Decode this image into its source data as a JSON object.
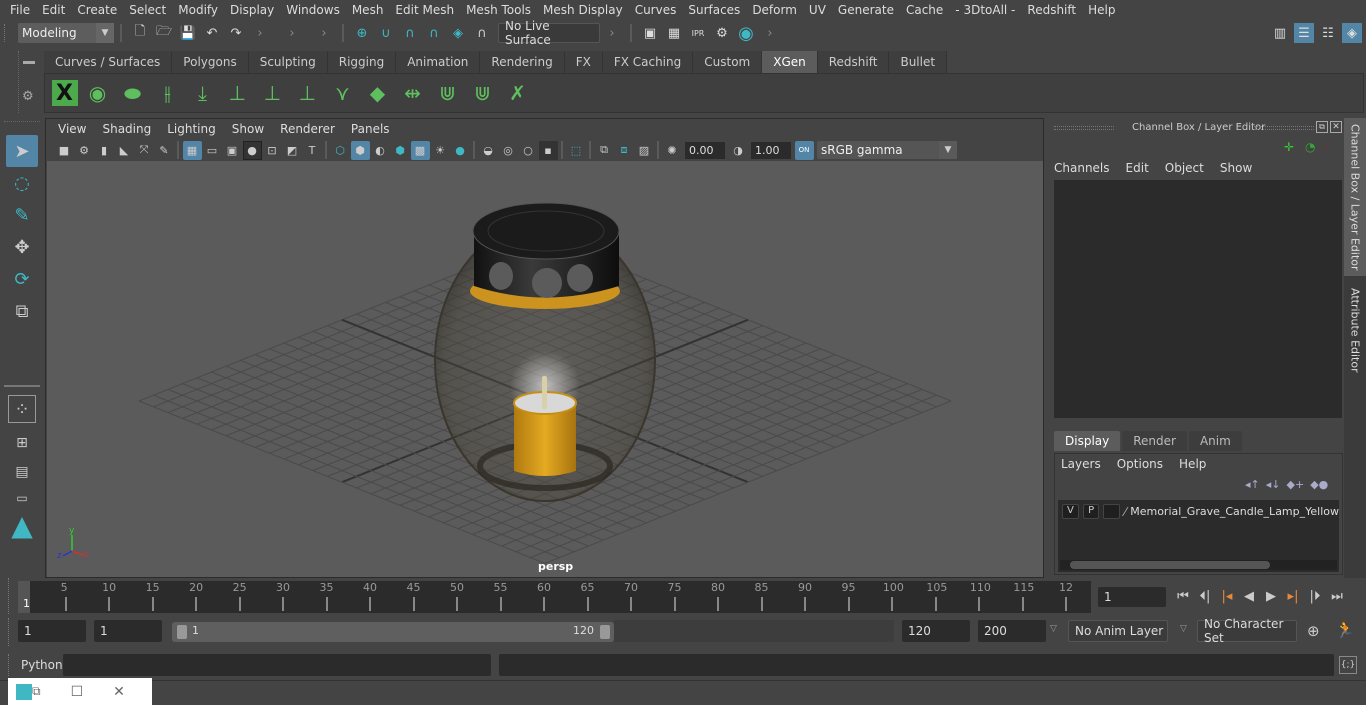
{
  "menubar": [
    "File",
    "Edit",
    "Create",
    "Select",
    "Modify",
    "Display",
    "Windows",
    "Mesh",
    "Edit Mesh",
    "Mesh Tools",
    "Mesh Display",
    "Curves",
    "Surfaces",
    "Deform",
    "UV",
    "Generate",
    "Cache",
    "- 3DtoAll -",
    "Redshift",
    "Help"
  ],
  "statusline": {
    "mode": "Modeling",
    "live_surface": "No Live Surface",
    "icons": [
      "new-scene-icon",
      "open-scene-icon",
      "save-scene-icon",
      "undo-icon",
      "redo-icon",
      "snap-grid-icon",
      "snap-curve-icon",
      "snap-point-icon",
      "snap-view-plane-icon",
      "snap-live-icon",
      "snap-magnet-icon",
      "render-view-icon",
      "render-icon",
      "ipr-render-icon",
      "render-settings-icon",
      "hypershade-icon"
    ],
    "right_icons": [
      "modeling-toolkit-icon",
      "attribute-editor-icon",
      "tool-settings-icon",
      "channel-box-icon"
    ]
  },
  "shelf": {
    "tabs": [
      "Curves / Surfaces",
      "Polygons",
      "Sculpting",
      "Rigging",
      "Animation",
      "Rendering",
      "FX",
      "FX Caching",
      "Custom",
      "XGen",
      "Redshift",
      "Bullet"
    ],
    "active_tab": "XGen",
    "icons": [
      "xgen-editor-icon",
      "xgen-preview-icon",
      "xgen-clear-preview-icon",
      "xgen-add-guides-icon",
      "xgen-place-guides-icon",
      "xgen-add-guide-icon",
      "xgen-show-guides-icon",
      "xgen-lock-guides-icon",
      "xgen-split-guide-icon",
      "xgen-sculpt-guides-icon",
      "xgen-flip-guides-icon",
      "xgen-select-guides-icon",
      "xgen-guide-bounds-icon",
      "xgen-delete-guides-icon"
    ]
  },
  "toolbox": [
    "select-tool-icon",
    "lasso-tool-icon",
    "paint-select-tool-icon",
    "move-tool-icon",
    "rotate-tool-icon",
    "scale-tool-icon"
  ],
  "viewport": {
    "menu": [
      "View",
      "Shading",
      "Lighting",
      "Show",
      "Renderer",
      "Panels"
    ],
    "exposure": "0.00",
    "gamma": "1.00",
    "color_space": "sRGB gamma",
    "color_mgmt_badge": "ON",
    "camera_label": "persp",
    "axis": {
      "x": "x",
      "y": "y",
      "z": "z"
    }
  },
  "channel_box": {
    "title": "Channel Box / Layer Editor",
    "menu": [
      "Channels",
      "Edit",
      "Object",
      "Show"
    ]
  },
  "layer_editor": {
    "tabs": [
      "Display",
      "Render",
      "Anim"
    ],
    "active_tab": "Display",
    "menu": [
      "Layers",
      "Options",
      "Help"
    ],
    "layers": [
      {
        "v": "V",
        "p": "P",
        "name": "Memorial_Grave_Candle_Lamp_Yellow"
      }
    ]
  },
  "side_tabs": [
    "Channel Box / Layer Editor",
    "Attribute Editor"
  ],
  "timeline": {
    "labels": [
      "5",
      "10",
      "15",
      "20",
      "25",
      "30",
      "35",
      "40",
      "45",
      "50",
      "55",
      "60",
      "65",
      "70",
      "75",
      "80",
      "85",
      "90",
      "95",
      "100",
      "105",
      "110",
      "115",
      "12"
    ],
    "current_frame_marker": "1",
    "current_frame": "1"
  },
  "range": {
    "start": "1",
    "playback_start": "1",
    "slider_start": "1",
    "slider_end": "120",
    "playback_end": "120",
    "end": "200",
    "anim_layer": "No Anim Layer",
    "character_set": "No Character Set"
  },
  "command_line": {
    "label": "Python"
  },
  "colors": {
    "accent": "#5285a6",
    "xgen_green": "#5fbf5f",
    "candle": "#e0a41a",
    "teal": "#3fb8c4",
    "orange": "#e88a3a"
  }
}
